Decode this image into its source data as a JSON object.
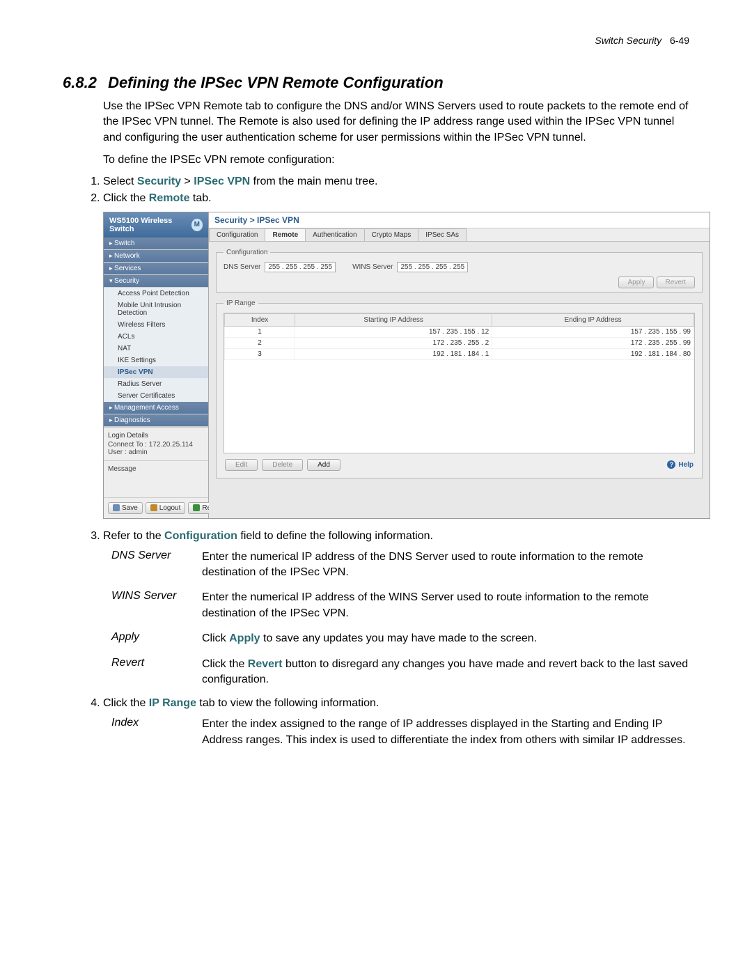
{
  "running_head": {
    "section": "Switch Security",
    "page": "6-49"
  },
  "title": {
    "number": "6.8.2",
    "text": "Defining the IPSec VPN Remote Configuration"
  },
  "intro": "Use the IPSec VPN Remote tab to configure the DNS and/or WINS Servers used to route packets to the remote end of the IPSec VPN tunnel. The Remote is also used for defining the IP address range used within the IPSec VPN tunnel and configuring the user authentication scheme for user permissions within the IPSec VPN tunnel.",
  "lead_in": "To define the IPSEc VPN remote configuration:",
  "step1": {
    "pre": "Select ",
    "a": "Security",
    "gt": " > ",
    "b": "IPSec VPN",
    "post": " from the main menu tree."
  },
  "step2": {
    "pre": "Click the ",
    "a": "Remote",
    "post": " tab."
  },
  "shot": {
    "title": "WS5100 Wireless Switch",
    "nav": {
      "switch": "Switch",
      "network": "Network",
      "services": "Services",
      "security": "Security",
      "subs": {
        "apd": "Access Point Detection",
        "muid": "Mobile Unit Intrusion Detection",
        "wf": "Wireless Filters",
        "acls": "ACLs",
        "nat": "NAT",
        "ike": "IKE Settings",
        "ipsec": "IPSec VPN",
        "radius": "Radius Server",
        "certs": "Server Certificates"
      },
      "mgmt": "Management Access",
      "diag": "Diagnostics"
    },
    "login": {
      "hdr": "Login Details",
      "connect_label": "Connect To :",
      "connect_val": "172.20.25.114",
      "user_label": "User :",
      "user_val": "admin"
    },
    "message_hdr": "Message",
    "buttons": {
      "save": "Save",
      "logout": "Logout",
      "refresh": "Refresh"
    },
    "crumb": "Security > IPSec VPN",
    "tabs": {
      "config": "Configuration",
      "remote": "Remote",
      "auth": "Authentication",
      "cmaps": "Crypto Maps",
      "sas": "IPSec SAs"
    },
    "config": {
      "legend": "Configuration",
      "dns_label": "DNS Server",
      "dns_value": "255 . 255 . 255 . 255",
      "wins_label": "WINS Server",
      "wins_value": "255 . 255 . 255 . 255",
      "apply": "Apply",
      "revert": "Revert"
    },
    "iprange": {
      "legend": "IP Range",
      "head_index": "Index",
      "head_start": "Starting IP Address",
      "head_end": "Ending IP Address",
      "rows": [
        {
          "idx": "1",
          "start": "157 . 235 . 155 . 12",
          "end": "157 . 235 . 155 . 99"
        },
        {
          "idx": "2",
          "start": "172 . 235 . 255 .  2",
          "end": "172 . 235 . 255 . 99"
        },
        {
          "idx": "3",
          "start": "192 . 181 . 184 .  1",
          "end": "192 . 181 . 184 . 80"
        }
      ]
    },
    "panel_buttons": {
      "edit": "Edit",
      "delete": "Delete",
      "add": "Add",
      "help": "Help"
    }
  },
  "step3": {
    "pre": "Refer to the ",
    "a": "Configuration",
    "post": " field to define the following information."
  },
  "defs1": {
    "dns": {
      "term": "DNS Server",
      "desc": "Enter the numerical IP address of the DNS Server used to route information to the remote destination of the IPSec VPN."
    },
    "wins": {
      "term": "WINS Server",
      "desc": "Enter the numerical IP address of the WINS Server used to route information to the remote destination of the IPSec VPN."
    },
    "apply": {
      "term": "Apply",
      "desc_pre": "Click ",
      "desc_bold": "Apply",
      "desc_post": " to save any updates you may have made to the screen."
    },
    "revert": {
      "term": "Revert",
      "desc_pre": "Click the ",
      "desc_bold": "Revert",
      "desc_post": " button to disregard any changes you have made and revert back to the last saved configuration."
    }
  },
  "step4": {
    "pre": "Click the ",
    "a": "IP Range",
    "post": " tab to view the following information."
  },
  "defs2": {
    "index": {
      "term": "Index",
      "desc": "Enter the index assigned to the range of IP addresses displayed in the Starting and Ending IP Address ranges. This index is used to differentiate the index from others with similar IP addresses."
    }
  }
}
